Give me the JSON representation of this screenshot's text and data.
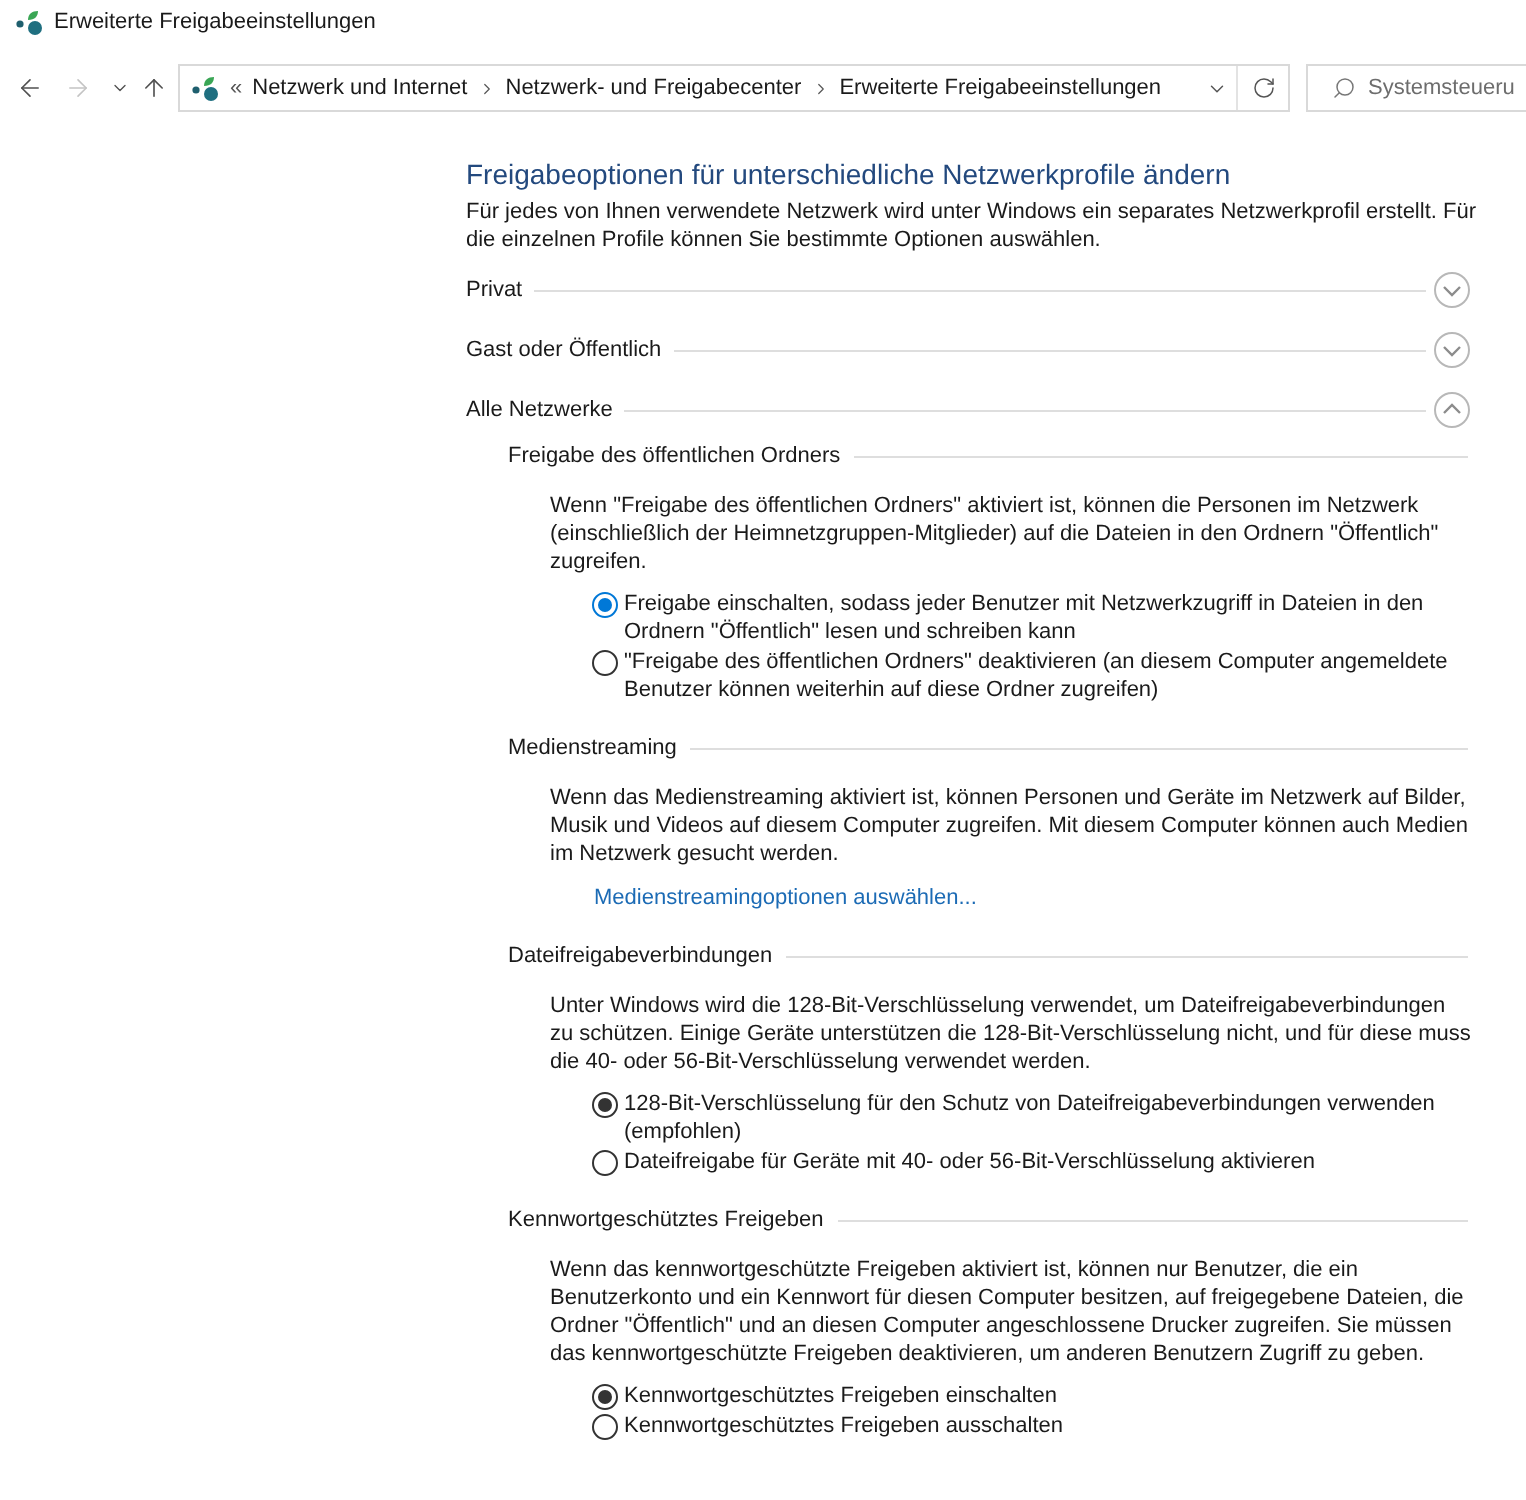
{
  "window": {
    "title": "Erweiterte Freigabeeinstellungen"
  },
  "nav_buttons": [
    {
      "kind": "back",
      "disabled": false
    },
    {
      "kind": "forward",
      "disabled": true
    },
    {
      "kind": "recent",
      "disabled": false
    },
    {
      "kind": "up",
      "disabled": false
    }
  ],
  "address_bar": {
    "overflow": "«",
    "crumbs": [
      "Netzwerk und Internet",
      "Netzwerk- und Freigabecenter",
      "Erweiterte Freigabeeinstellungen"
    ]
  },
  "search": {
    "placeholder": "Systemsteueru"
  },
  "content": {
    "heading": "Freigabeoptionen für unterschiedliche Netzwerkprofile ändern",
    "description": "Für jedes von Ihnen verwendete Netzwerk wird unter Windows ein separates Netzwerkprofil erstellt. Für die einzelnen Profile können Sie bestimmte Optionen auswählen.",
    "profiles": [
      {
        "label": "Privat",
        "expanded": false
      },
      {
        "label": "Gast oder Öffentlich",
        "expanded": false
      },
      {
        "label": "Alle Netzwerke",
        "expanded": true,
        "sections": [
          {
            "kind": "radio",
            "title": "Freigabe des öffentlichen Ordners",
            "description": "Wenn \"Freigabe des öffentlichen Ordners\" aktiviert ist, können die Personen im Netzwerk (einschließlich der Heimnetzgruppen-Mitglieder) auf die Dateien in den Ordnern \"Öffentlich\" zugreifen.",
            "options": [
              {
                "label": "Freigabe einschalten, sodass jeder Benutzer mit Netzwerkzugriff in Dateien in den Ordnern \"Öffentlich\" lesen und schreiben kann",
                "selected": true,
                "color": "#0078d7"
              },
              {
                "label": "\"Freigabe des öffentlichen Ordners\" deaktivieren (an diesem Computer angemeldete Benutzer können weiterhin auf diese Ordner zugreifen)",
                "selected": false,
                "color": "#333333"
              }
            ]
          },
          {
            "kind": "link",
            "title": "Medienstreaming",
            "description": "Wenn das Medienstreaming aktiviert ist, können Personen und Geräte im Netzwerk auf Bilder, Musik und Videos auf diesem Computer zugreifen. Mit diesem Computer können auch Medien im Netzwerk gesucht werden.",
            "link": "Medienstreamingoptionen auswählen..."
          },
          {
            "kind": "radio",
            "title": "Dateifreigabeverbindungen",
            "description": "Unter Windows wird die 128-Bit-Verschlüsselung verwendet, um Dateifreigabeverbindungen zu schützen. Einige Geräte unterstützen die 128-Bit-Verschlüsselung nicht, und für diese muss die 40- oder 56-Bit-Verschlüsselung verwendet werden.",
            "options": [
              {
                "label": "128-Bit-Verschlüsselung für den Schutz von Dateifreigabeverbindungen verwenden (empfohlen)",
                "selected": true,
                "color": "#333333"
              },
              {
                "label": "Dateifreigabe für Geräte mit 40- oder 56-Bit-Verschlüsselung aktivieren",
                "selected": false,
                "color": "#333333"
              }
            ]
          },
          {
            "kind": "radio",
            "title": "Kennwortgeschütztes Freigeben",
            "description": "Wenn das kennwortgeschützte Freigeben aktiviert ist, können nur Benutzer, die ein Benutzerkonto und ein Kennwort für diesen Computer besitzen, auf freigegebene Dateien, die Ordner \"Öffentlich\" und an diesen Computer angeschlossene Drucker zugreifen. Sie müssen das kennwortgeschützte Freigeben deaktivieren, um anderen Benutzern Zugriff zu geben.",
            "options": [
              {
                "label": "Kennwortgeschütztes Freigeben einschalten",
                "selected": true,
                "color": "#333333"
              },
              {
                "label": "Kennwortgeschütztes Freigeben ausschalten",
                "selected": false,
                "color": "#333333"
              }
            ]
          }
        ]
      }
    ]
  }
}
